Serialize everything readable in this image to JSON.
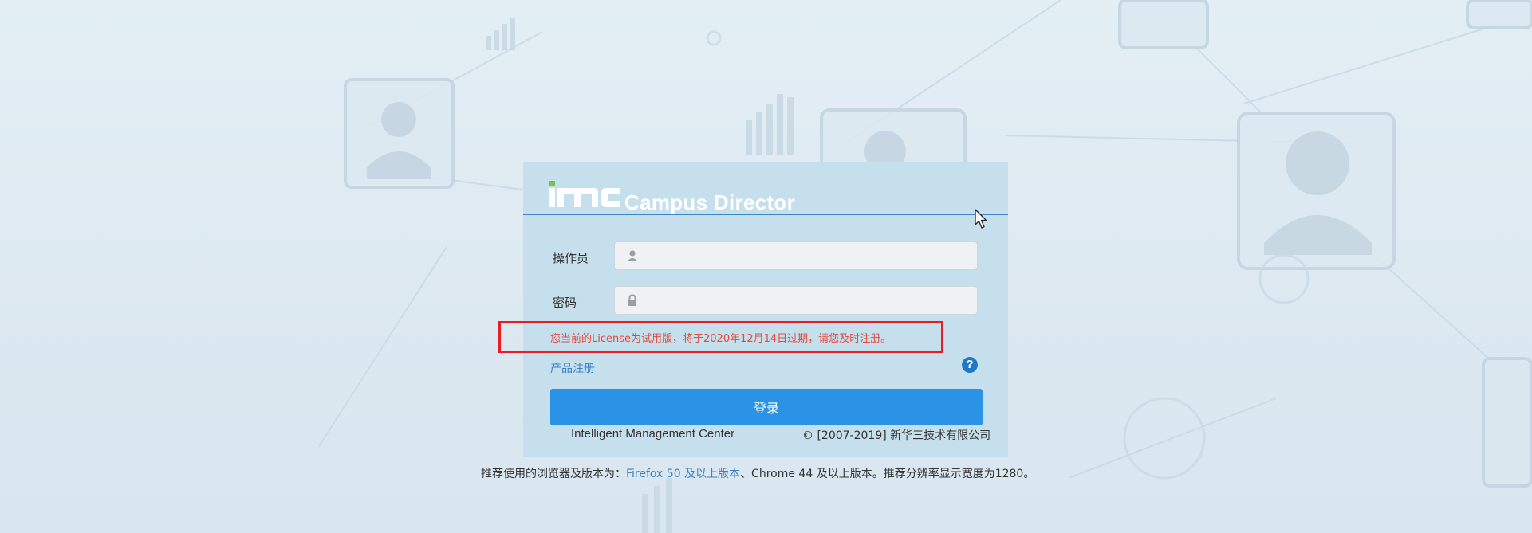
{
  "app": {
    "logo_text": "Campus Director",
    "logo_mark": "iMC"
  },
  "form": {
    "operator_label": "操作员",
    "password_label": "密码",
    "operator_value": "",
    "password_value": "",
    "operator_icon": "user-icon",
    "password_icon": "lock-icon"
  },
  "license": {
    "message": "您当前的License为试用版，将于2020年12月14日过期，请您及时注册。"
  },
  "links": {
    "product_register": "产品注册",
    "help_icon": "help-icon"
  },
  "actions": {
    "login_label": "登录"
  },
  "footer": {
    "product_name": "Intelligent Management Center",
    "copyright": "© [2007-2019] 新华三技术有限公司"
  },
  "browser_note": {
    "prefix": "推荐使用的浏览器及版本为：",
    "firefox": "Firefox 50 及以上版本",
    "rest": "、Chrome 44 及以上版本。推荐分辨率显示宽度为1280。"
  },
  "colors": {
    "panel": "#c5dfed",
    "button": "#2a93e6",
    "warning_text": "#e0493d",
    "highlight_border": "#ea1b22",
    "link": "#3a82c2",
    "logo_green": "#7dc142"
  }
}
